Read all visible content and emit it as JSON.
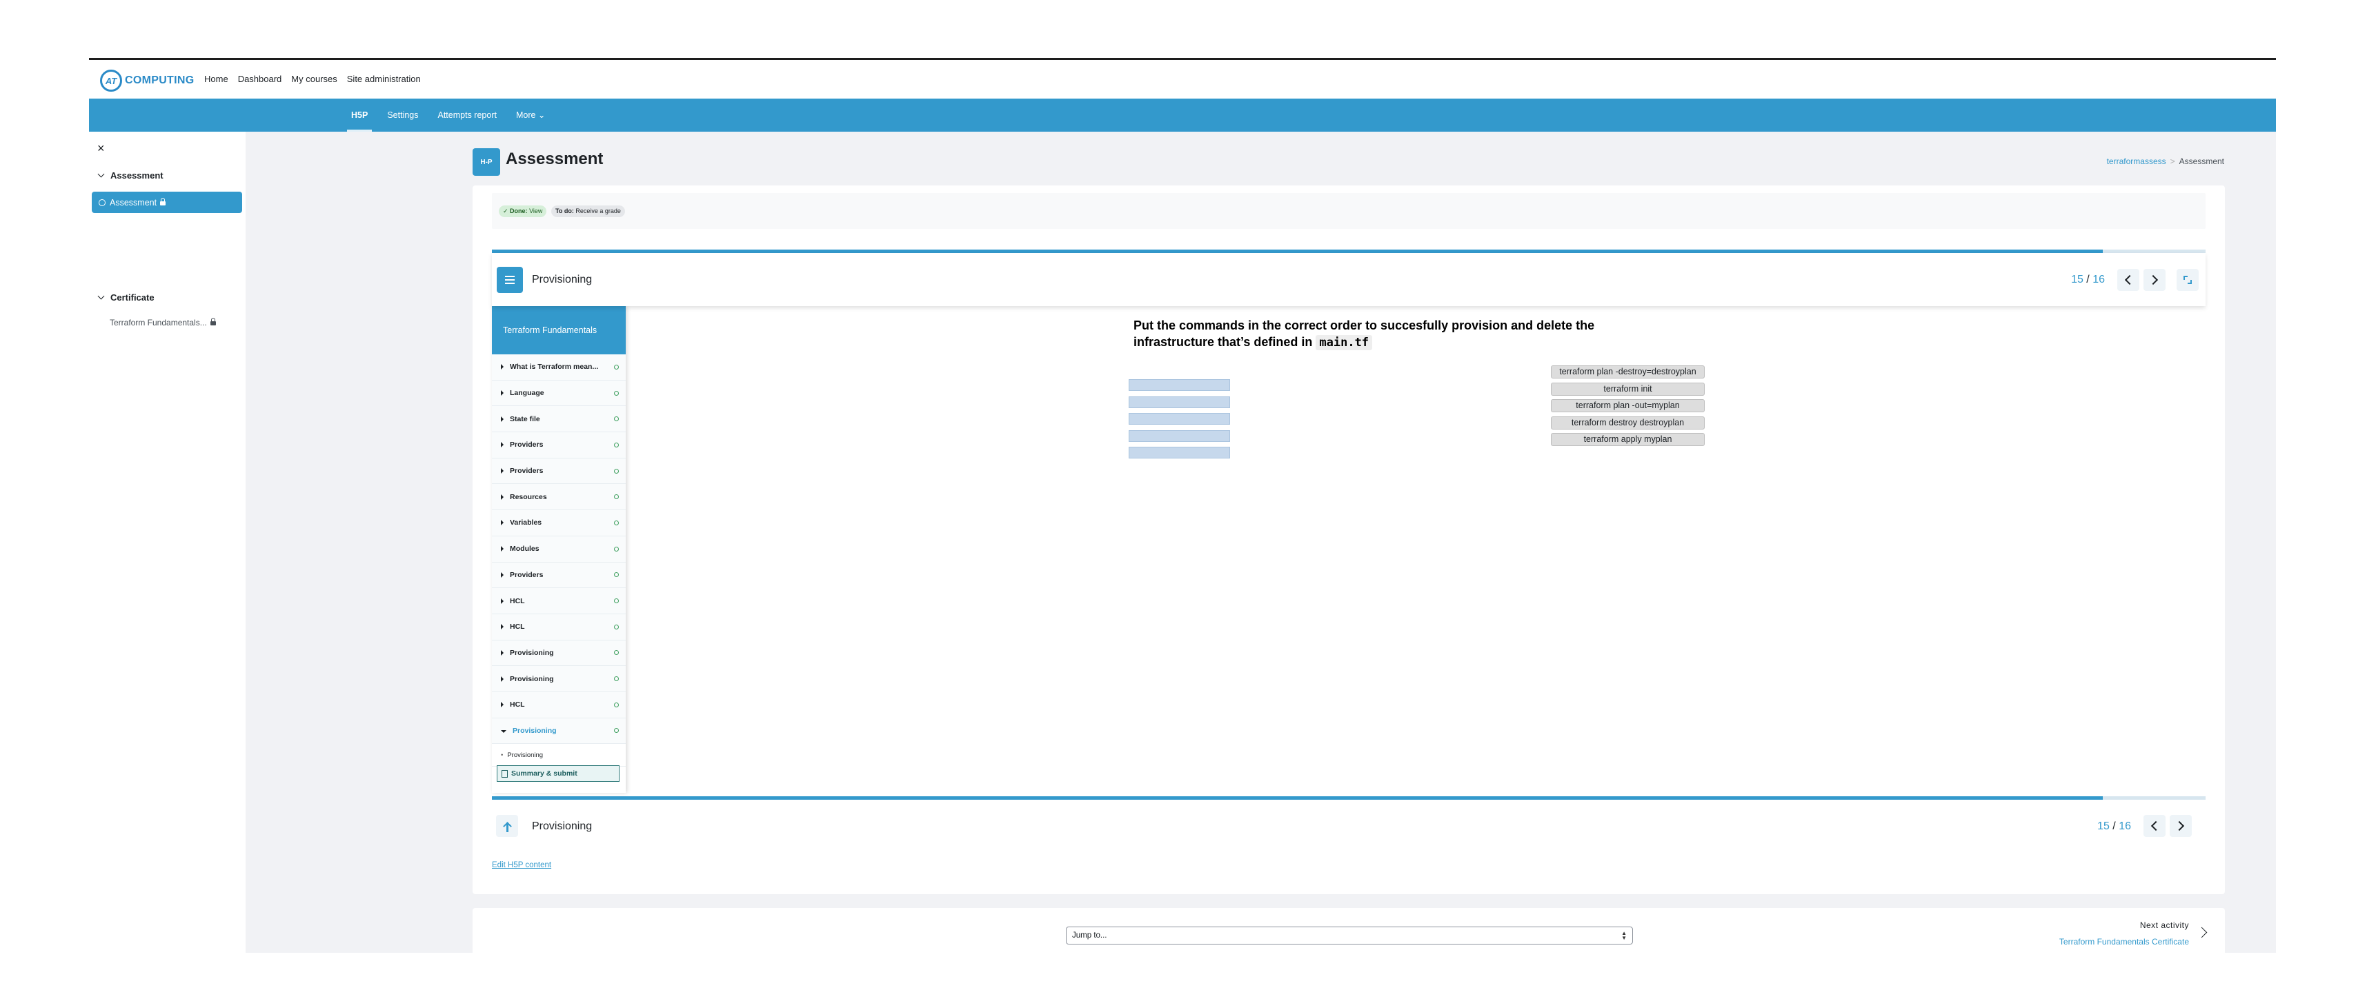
{
  "brand": {
    "name": "COMPUTING",
    "sub": ""
  },
  "primary_nav": [
    "Home",
    "Dashboard",
    "My courses",
    "Site administration"
  ],
  "secondary_nav": {
    "items": [
      "H5P",
      "Settings",
      "Attempts report",
      "More ⌄"
    ],
    "active": "H5P"
  },
  "drawer": {
    "close": "×",
    "sections": [
      "Assessment",
      "Certificate"
    ],
    "active_item": "Assessment",
    "certificate_item": "Terraform Fundamentals..."
  },
  "page": {
    "title": "Assessment",
    "h5p_icon": "H‑P",
    "breadcrumb": [
      "terraformassess",
      "Assessment"
    ]
  },
  "completion": {
    "done_label": "✓ Done:",
    "done_value": "View",
    "todo_label": "To do:",
    "todo_value": "Receive a grade"
  },
  "progress_fraction": 0.94,
  "h5p": {
    "chapter_title": "Provisioning",
    "page_current": "15",
    "page_sep": " / ",
    "page_total": "16",
    "toc_title": "Terraform Fundamentals",
    "toc_items": [
      "What is Terraform mean...",
      "Language",
      "State file",
      "Providers",
      "Providers",
      "Resources",
      "Variables",
      "Modules",
      "Providers",
      "HCL",
      "HCL",
      "Provisioning",
      "Provisioning",
      "HCL",
      "Provisioning"
    ],
    "toc_sub_item": "Provisioning",
    "summary_button": "Summary & submit",
    "question_text": "Put the commands in the correct order to succesfully provision and delete the infrastructure that’s defined in",
    "question_code": "main.tf",
    "draggables": [
      "terraform plan -destroy=destroyplan",
      "terraform init",
      "terraform plan -out=myplan",
      "terraform destroy destroyplan",
      "terraform apply myplan"
    ],
    "dropzone_count": 5
  },
  "edit_link": "Edit H5P content",
  "activity_nav": {
    "jump_placeholder": "Jump to...",
    "next_label": "Next activity",
    "next_link": "Terraform Fundamentals Certificate"
  },
  "colors": {
    "accent": "#3399cc",
    "background": "#f1f2f5",
    "dropzone": "#c6d8ec",
    "draggable": "#dddddd"
  }
}
